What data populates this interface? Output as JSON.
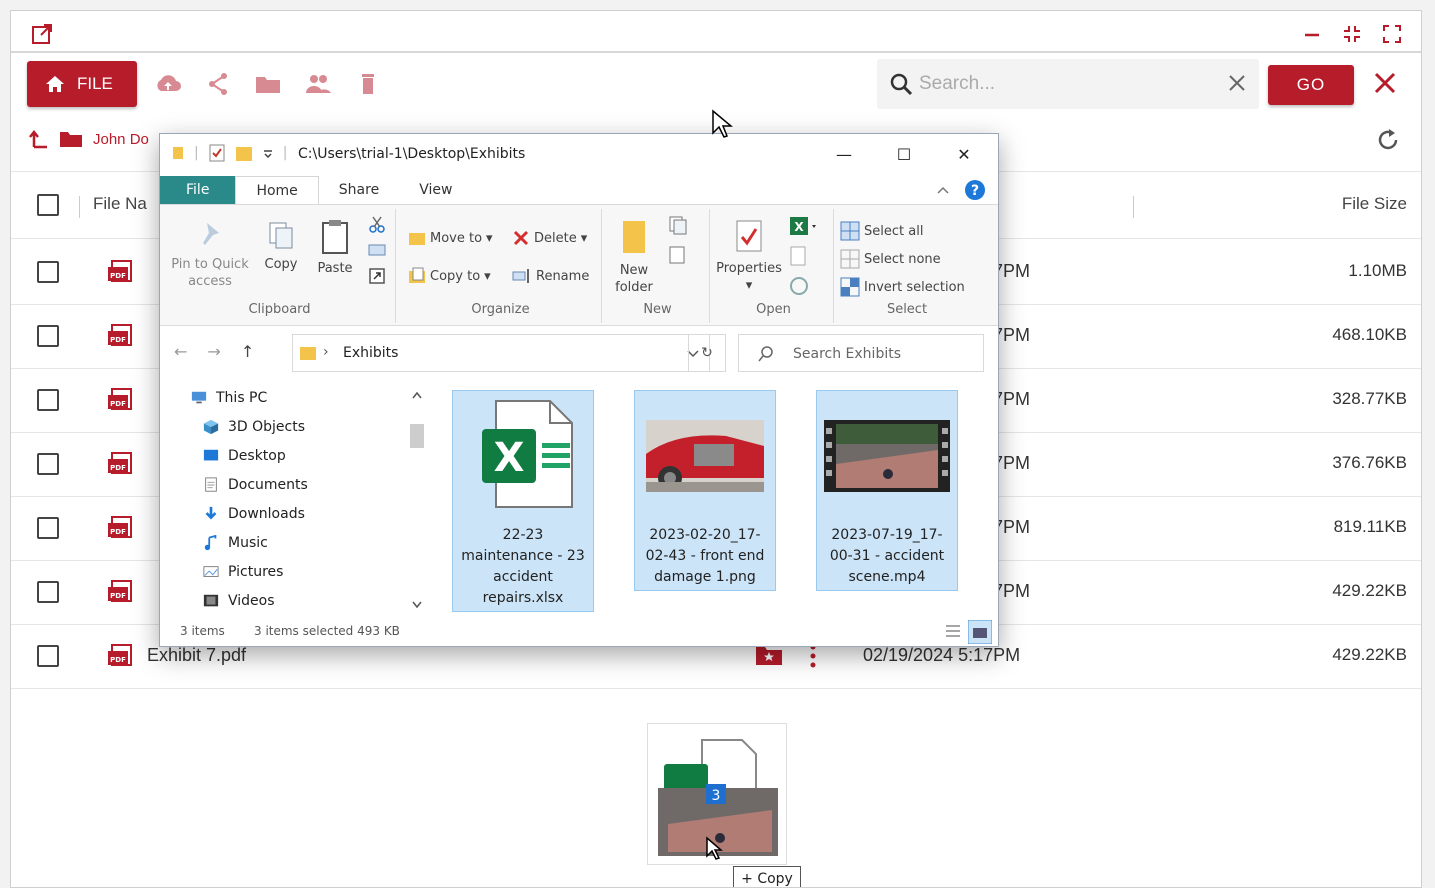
{
  "app": {
    "file_label": "FILE",
    "search_placeholder": "Search...",
    "go_label": "GO",
    "breadcrumb": "John Do",
    "columns": {
      "name": "File Na",
      "size": "File Size"
    },
    "rows": [
      {
        "name": "",
        "date": "7PM",
        "size": "1.10MB"
      },
      {
        "name": "",
        "date": "7PM",
        "size": "468.10KB"
      },
      {
        "name": "",
        "date": "7PM",
        "size": "328.77KB"
      },
      {
        "name": "",
        "date": "7PM",
        "size": "376.76KB"
      },
      {
        "name": "",
        "date": "7PM",
        "size": "819.11KB"
      },
      {
        "name": "",
        "date": "7PM",
        "size": "429.22KB"
      },
      {
        "name": "Exhibit 7.pdf",
        "date": "02/19/2024 5:17PM",
        "size": "429.22KB"
      }
    ],
    "accent_color": "#b71c2b"
  },
  "explorer": {
    "path": "C:\\Users\\trial-1\\Desktop\\Exhibits",
    "tabs": [
      "File",
      "Home",
      "Share",
      "View"
    ],
    "ribbon": {
      "clipboard": {
        "label": "Clipboard",
        "pin": "Pin to Quick access",
        "copy": "Copy",
        "paste": "Paste"
      },
      "organize": {
        "label": "Organize",
        "move_to": "Move to",
        "delete": "Delete",
        "copy_to": "Copy to",
        "rename": "Rename"
      },
      "new": {
        "label": "New",
        "new_folder": "New folder"
      },
      "open": {
        "label": "Open",
        "properties": "Properties"
      },
      "select": {
        "label": "Select",
        "select_all": "Select all",
        "select_none": "Select none",
        "invert": "Invert selection"
      }
    },
    "address": "Exhibits",
    "search_placeholder": "Search Exhibits",
    "nav": [
      "This PC",
      "3D Objects",
      "Desktop",
      "Documents",
      "Downloads",
      "Music",
      "Pictures",
      "Videos"
    ],
    "files": [
      {
        "name": "22-23 maintenance - 23 accident repairs.xlsx"
      },
      {
        "name": "2023-02-20_17-02-43 - front end damage 1.png"
      },
      {
        "name": "2023-07-19_17-00-31 - accident scene.mp4"
      }
    ],
    "status_items": "3 items",
    "status_selected": "3 items selected  493 KB"
  },
  "drag": {
    "count": "3",
    "tip": "+ Copy"
  }
}
